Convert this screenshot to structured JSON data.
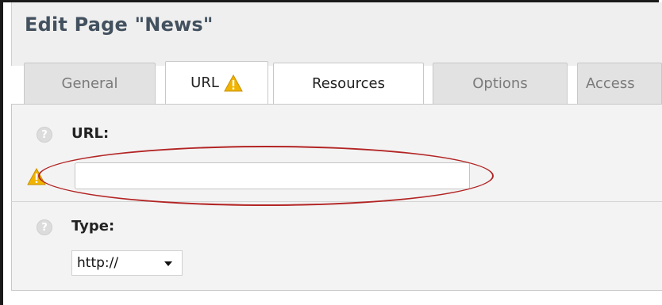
{
  "header": {
    "title": "Edit Page \"News\""
  },
  "tabs": [
    {
      "label": "General"
    },
    {
      "label": "URL"
    },
    {
      "label": "Resources"
    },
    {
      "label": "Options"
    },
    {
      "label": "Access"
    }
  ],
  "form": {
    "url": {
      "label": "URL:",
      "value": ""
    },
    "type": {
      "label": "Type:",
      "selected": "http://"
    }
  },
  "colors": {
    "highlight": "#b32424",
    "warning": "#f0b400"
  },
  "icons": {
    "help": "help-icon",
    "warning": "warning-icon",
    "caret": "chevron-down-icon"
  }
}
